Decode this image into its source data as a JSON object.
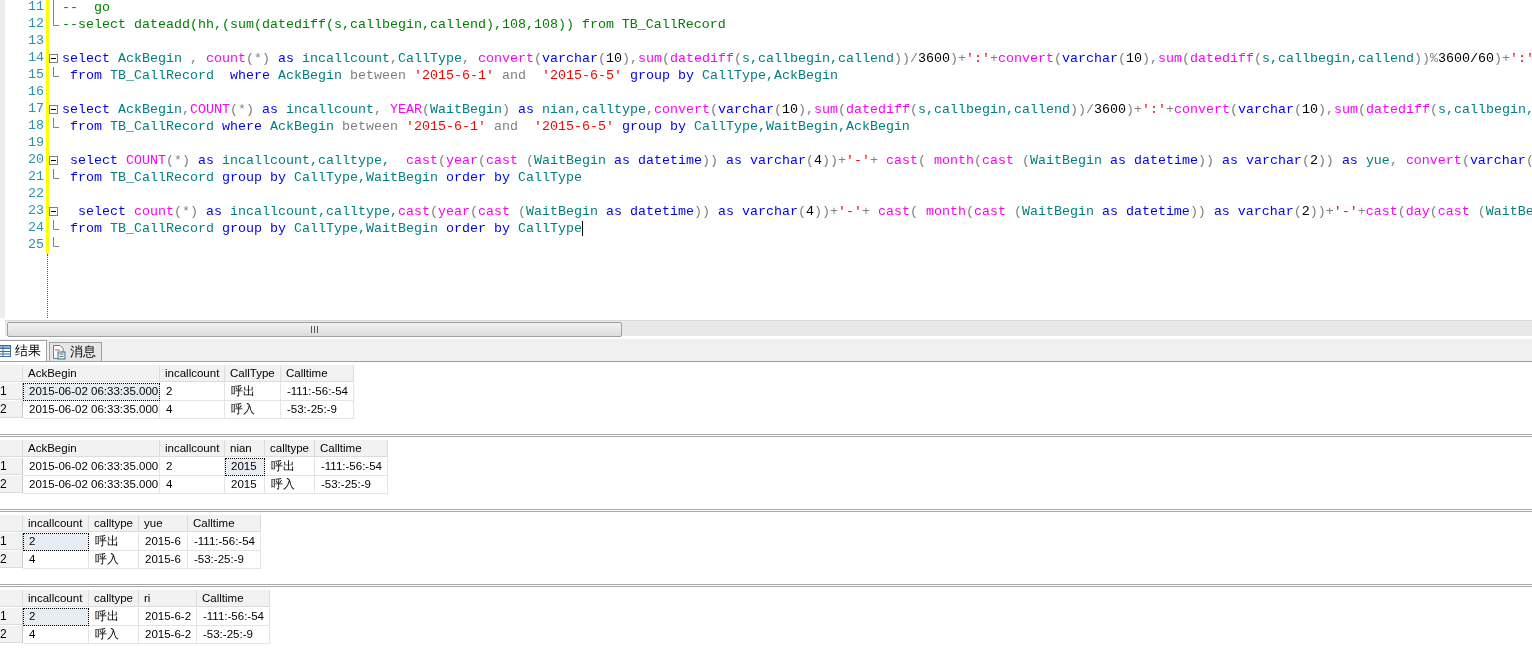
{
  "editor": {
    "lines": [
      {
        "number": "11",
        "kind": "guide",
        "caret": false,
        "tokens": [
          {
            "text": "--  go",
            "kind": "cmt"
          }
        ]
      },
      {
        "number": "12",
        "kind": "end",
        "caret": false,
        "tokens": [
          {
            "text": "--select dateadd(hh,(sum(datediff(s,callbegin,callend),108,108)) from TB_CallRecord",
            "kind": "cmt"
          }
        ]
      },
      {
        "number": "13",
        "caret": false
      },
      {
        "number": "14",
        "kind": "start",
        "caret": false,
        "tokens": [
          {
            "text": "select ",
            "kind": "kw"
          },
          {
            "text": "AckBegin ",
            "kind": "id"
          },
          {
            "text": ", ",
            "kind": "op"
          },
          {
            "text": "count",
            "kind": "fn"
          },
          {
            "text": "(*) ",
            "kind": "op"
          },
          {
            "text": "as ",
            "kind": "kw"
          },
          {
            "text": "incallcount",
            "kind": "id"
          },
          {
            "text": ",",
            "kind": "op"
          },
          {
            "text": "CallType",
            "kind": "id"
          },
          {
            "text": ", ",
            "kind": "op"
          },
          {
            "text": "convert",
            "kind": "fn"
          },
          {
            "text": "(",
            "kind": "op"
          },
          {
            "text": "varchar",
            "kind": "kw"
          },
          {
            "text": "(",
            "kind": "op"
          },
          {
            "text": "10",
            "kind": "num"
          },
          {
            "text": "),",
            "kind": "op"
          },
          {
            "text": "sum",
            "kind": "fn"
          },
          {
            "text": "(",
            "kind": "op"
          },
          {
            "text": "datediff",
            "kind": "fn"
          },
          {
            "text": "(",
            "kind": "op"
          },
          {
            "text": "s,callbegin,callend",
            "kind": "id"
          },
          {
            "text": "))/",
            "kind": "op"
          },
          {
            "text": "3600",
            "kind": "num"
          },
          {
            "text": ")+",
            "kind": "op"
          },
          {
            "text": "':'",
            "kind": "str"
          },
          {
            "text": "+",
            "kind": "op"
          },
          {
            "text": "convert",
            "kind": "fn"
          },
          {
            "text": "(",
            "kind": "op"
          },
          {
            "text": "varchar",
            "kind": "kw"
          },
          {
            "text": "(",
            "kind": "op"
          },
          {
            "text": "10",
            "kind": "num"
          },
          {
            "text": "),",
            "kind": "op"
          },
          {
            "text": "sum",
            "kind": "fn"
          },
          {
            "text": "(",
            "kind": "op"
          },
          {
            "text": "datediff",
            "kind": "fn"
          },
          {
            "text": "(",
            "kind": "op"
          },
          {
            "text": "s,callbegin,callend",
            "kind": "id"
          },
          {
            "text": "))%",
            "kind": "op"
          },
          {
            "text": "3600/60",
            "kind": "num"
          },
          {
            "text": ")+",
            "kind": "op"
          },
          {
            "text": "':'",
            "kind": "str"
          }
        ]
      },
      {
        "number": "15",
        "kind": "end",
        "caret": false,
        "tokens": [
          {
            "text": " from ",
            "kind": "kw"
          },
          {
            "text": "TB_CallRecord  ",
            "kind": "id"
          },
          {
            "text": "where ",
            "kind": "kw"
          },
          {
            "text": "AckBegin ",
            "kind": "id"
          },
          {
            "text": "between ",
            "kind": "op"
          },
          {
            "text": "'2015-6-1'",
            "kind": "str"
          },
          {
            "text": " and  ",
            "kind": "op"
          },
          {
            "text": "'2015-6-5'",
            "kind": "str"
          },
          {
            "text": " group by ",
            "kind": "kw"
          },
          {
            "text": "CallType,AckBegin",
            "kind": "id"
          }
        ]
      },
      {
        "number": "16",
        "caret": false
      },
      {
        "number": "17",
        "kind": "start",
        "caret": false,
        "tokens": [
          {
            "text": "select ",
            "kind": "kw"
          },
          {
            "text": "AckBegin",
            "kind": "id"
          },
          {
            "text": ",",
            "kind": "op"
          },
          {
            "text": "COUNT",
            "kind": "fn"
          },
          {
            "text": "(*) ",
            "kind": "op"
          },
          {
            "text": "as ",
            "kind": "kw"
          },
          {
            "text": "incallcount",
            "kind": "id"
          },
          {
            "text": ", ",
            "kind": "op"
          },
          {
            "text": "YEAR",
            "kind": "fn"
          },
          {
            "text": "(",
            "kind": "op"
          },
          {
            "text": "WaitBegin",
            "kind": "id"
          },
          {
            "text": ") ",
            "kind": "op"
          },
          {
            "text": "as ",
            "kind": "kw"
          },
          {
            "text": "nian,calltype",
            "kind": "id"
          },
          {
            "text": ",",
            "kind": "op"
          },
          {
            "text": "convert",
            "kind": "fn"
          },
          {
            "text": "(",
            "kind": "op"
          },
          {
            "text": "varchar",
            "kind": "kw"
          },
          {
            "text": "(",
            "kind": "op"
          },
          {
            "text": "10",
            "kind": "num"
          },
          {
            "text": "),",
            "kind": "op"
          },
          {
            "text": "sum",
            "kind": "fn"
          },
          {
            "text": "(",
            "kind": "op"
          },
          {
            "text": "datediff",
            "kind": "fn"
          },
          {
            "text": "(",
            "kind": "op"
          },
          {
            "text": "s,callbegin,callend",
            "kind": "id"
          },
          {
            "text": "))/",
            "kind": "op"
          },
          {
            "text": "3600",
            "kind": "num"
          },
          {
            "text": ")+",
            "kind": "op"
          },
          {
            "text": "':'",
            "kind": "str"
          },
          {
            "text": "+",
            "kind": "op"
          },
          {
            "text": "convert",
            "kind": "fn"
          },
          {
            "text": "(",
            "kind": "op"
          },
          {
            "text": "varchar",
            "kind": "kw"
          },
          {
            "text": "(",
            "kind": "op"
          },
          {
            "text": "10",
            "kind": "num"
          },
          {
            "text": "),",
            "kind": "op"
          },
          {
            "text": "sum",
            "kind": "fn"
          },
          {
            "text": "(",
            "kind": "op"
          },
          {
            "text": "datediff",
            "kind": "fn"
          },
          {
            "text": "(",
            "kind": "op"
          },
          {
            "text": "s,callbegin,",
            "kind": "id"
          }
        ]
      },
      {
        "number": "18",
        "kind": "end",
        "caret": false,
        "tokens": [
          {
            "text": " from ",
            "kind": "kw"
          },
          {
            "text": "TB_CallRecord ",
            "kind": "id"
          },
          {
            "text": "where ",
            "kind": "kw"
          },
          {
            "text": "AckBegin ",
            "kind": "id"
          },
          {
            "text": "between ",
            "kind": "op"
          },
          {
            "text": "'2015-6-1'",
            "kind": "str"
          },
          {
            "text": " and  ",
            "kind": "op"
          },
          {
            "text": "'2015-6-5'",
            "kind": "str"
          },
          {
            "text": " group by ",
            "kind": "kw"
          },
          {
            "text": "CallType,WaitBegin,AckBegin",
            "kind": "id"
          }
        ]
      },
      {
        "number": "19",
        "caret": false
      },
      {
        "number": "20",
        "kind": "start",
        "caret": false,
        "tokens": [
          {
            "text": " select ",
            "kind": "kw"
          },
          {
            "text": "COUNT",
            "kind": "fn"
          },
          {
            "text": "(*) ",
            "kind": "op"
          },
          {
            "text": "as ",
            "kind": "kw"
          },
          {
            "text": "incallcount,calltype,  ",
            "kind": "id"
          },
          {
            "text": "cast",
            "kind": "fn"
          },
          {
            "text": "(",
            "kind": "op"
          },
          {
            "text": "year",
            "kind": "fn"
          },
          {
            "text": "(",
            "kind": "op"
          },
          {
            "text": "cast",
            "kind": "fn"
          },
          {
            "text": " (",
            "kind": "op"
          },
          {
            "text": "WaitBegin ",
            "kind": "id"
          },
          {
            "text": "as datetime",
            "kind": "kw"
          },
          {
            "text": ")) ",
            "kind": "op"
          },
          {
            "text": "as varchar",
            "kind": "kw"
          },
          {
            "text": "(",
            "kind": "op"
          },
          {
            "text": "4",
            "kind": "num"
          },
          {
            "text": "))+",
            "kind": "op"
          },
          {
            "text": "'-'",
            "kind": "str"
          },
          {
            "text": "+ ",
            "kind": "op"
          },
          {
            "text": "cast",
            "kind": "fn"
          },
          {
            "text": "( ",
            "kind": "op"
          },
          {
            "text": "month",
            "kind": "fn"
          },
          {
            "text": "(",
            "kind": "op"
          },
          {
            "text": "cast",
            "kind": "fn"
          },
          {
            "text": " (",
            "kind": "op"
          },
          {
            "text": "WaitBegin ",
            "kind": "id"
          },
          {
            "text": "as datetime",
            "kind": "kw"
          },
          {
            "text": ")) ",
            "kind": "op"
          },
          {
            "text": "as varchar",
            "kind": "kw"
          },
          {
            "text": "(",
            "kind": "op"
          },
          {
            "text": "2",
            "kind": "num"
          },
          {
            "text": ")) ",
            "kind": "op"
          },
          {
            "text": "as ",
            "kind": "kw"
          },
          {
            "text": "yue",
            "kind": "id"
          },
          {
            "text": ", ",
            "kind": "op"
          },
          {
            "text": "convert",
            "kind": "fn"
          },
          {
            "text": "(",
            "kind": "op"
          },
          {
            "text": "varchar",
            "kind": "kw"
          },
          {
            "text": "(",
            "kind": "op"
          }
        ]
      },
      {
        "number": "21",
        "kind": "end",
        "caret": false,
        "tokens": [
          {
            "text": " from ",
            "kind": "kw"
          },
          {
            "text": "TB_CallRecord ",
            "kind": "id"
          },
          {
            "text": "group by ",
            "kind": "kw"
          },
          {
            "text": "CallType,WaitBegin ",
            "kind": "id"
          },
          {
            "text": "order by ",
            "kind": "kw"
          },
          {
            "text": "CallType",
            "kind": "id"
          }
        ]
      },
      {
        "number": "22",
        "caret": false
      },
      {
        "number": "23",
        "kind": "start",
        "caret": false,
        "tokens": [
          {
            "text": "  select ",
            "kind": "kw"
          },
          {
            "text": "count",
            "kind": "fn"
          },
          {
            "text": "(*) ",
            "kind": "op"
          },
          {
            "text": "as ",
            "kind": "kw"
          },
          {
            "text": "incallcount,calltype,",
            "kind": "id"
          },
          {
            "text": "cast",
            "kind": "fn"
          },
          {
            "text": "(",
            "kind": "op"
          },
          {
            "text": "year",
            "kind": "fn"
          },
          {
            "text": "(",
            "kind": "op"
          },
          {
            "text": "cast",
            "kind": "fn"
          },
          {
            "text": " (",
            "kind": "op"
          },
          {
            "text": "WaitBegin ",
            "kind": "id"
          },
          {
            "text": "as datetime",
            "kind": "kw"
          },
          {
            "text": ")) ",
            "kind": "op"
          },
          {
            "text": "as varchar",
            "kind": "kw"
          },
          {
            "text": "(",
            "kind": "op"
          },
          {
            "text": "4",
            "kind": "num"
          },
          {
            "text": "))+",
            "kind": "op"
          },
          {
            "text": "'-'",
            "kind": "str"
          },
          {
            "text": "+ ",
            "kind": "op"
          },
          {
            "text": "cast",
            "kind": "fn"
          },
          {
            "text": "( ",
            "kind": "op"
          },
          {
            "text": "month",
            "kind": "fn"
          },
          {
            "text": "(",
            "kind": "op"
          },
          {
            "text": "cast",
            "kind": "fn"
          },
          {
            "text": " (",
            "kind": "op"
          },
          {
            "text": "WaitBegin ",
            "kind": "id"
          },
          {
            "text": "as datetime",
            "kind": "kw"
          },
          {
            "text": ")) ",
            "kind": "op"
          },
          {
            "text": "as varchar",
            "kind": "kw"
          },
          {
            "text": "(",
            "kind": "op"
          },
          {
            "text": "2",
            "kind": "num"
          },
          {
            "text": "))+",
            "kind": "op"
          },
          {
            "text": "'-'",
            "kind": "str"
          },
          {
            "text": "+",
            "kind": "op"
          },
          {
            "text": "cast",
            "kind": "fn"
          },
          {
            "text": "(",
            "kind": "op"
          },
          {
            "text": "day",
            "kind": "fn"
          },
          {
            "text": "(",
            "kind": "op"
          },
          {
            "text": "cast",
            "kind": "fn"
          },
          {
            "text": " (",
            "kind": "op"
          },
          {
            "text": "WaitBe",
            "kind": "id"
          }
        ]
      },
      {
        "number": "24",
        "kind": "end",
        "caret": true,
        "tokens": [
          {
            "text": " from ",
            "kind": "kw"
          },
          {
            "text": "TB_CallRecord ",
            "kind": "id"
          },
          {
            "text": "group by ",
            "kind": "kw"
          },
          {
            "text": "CallType,WaitBegin ",
            "kind": "id"
          },
          {
            "text": "order by ",
            "kind": "kw"
          },
          {
            "text": "CallType",
            "kind": "id"
          }
        ]
      },
      {
        "number": "25",
        "kind": "end",
        "caret": false
      }
    ]
  },
  "result_tabs": [
    {
      "label": "结果",
      "selected": true
    },
    {
      "label": "消息",
      "selected": false
    }
  ],
  "grids": [
    {
      "columns": [
        "AckBegin",
        "incallcount",
        "CallType",
        "Calltime"
      ],
      "rows": [
        {
          "number": "1",
          "cells": [
            {
              "text": "2015-06-02 06:33:35.000",
              "selected": true
            },
            {
              "text": "2",
              "selected": false
            },
            {
              "text": "呼出",
              "selected": false
            },
            {
              "text": "-111:-56:-54",
              "selected": false
            }
          ]
        },
        {
          "number": "2",
          "cells": [
            {
              "text": "2015-06-02 06:33:35.000",
              "selected": false
            },
            {
              "text": "4",
              "selected": false
            },
            {
              "text": "呼入",
              "selected": false
            },
            {
              "text": "-53:-25:-9",
              "selected": false
            }
          ]
        }
      ]
    },
    {
      "columns": [
        "AckBegin",
        "incallcount",
        "nian",
        "calltype",
        "Calltime"
      ],
      "rows": [
        {
          "number": "1",
          "cells": [
            {
              "text": "2015-06-02 06:33:35.000",
              "selected": false
            },
            {
              "text": "2",
              "selected": false
            },
            {
              "text": "2015",
              "selected": true
            },
            {
              "text": "呼出",
              "selected": false
            },
            {
              "text": "-111:-56:-54",
              "selected": false
            }
          ]
        },
        {
          "number": "2",
          "cells": [
            {
              "text": "2015-06-02 06:33:35.000",
              "selected": false
            },
            {
              "text": "4",
              "selected": false
            },
            {
              "text": "2015",
              "selected": false
            },
            {
              "text": "呼入",
              "selected": false
            },
            {
              "text": "-53:-25:-9",
              "selected": false
            }
          ]
        }
      ]
    },
    {
      "columns": [
        "incallcount",
        "calltype",
        "yue",
        "Calltime"
      ],
      "rows": [
        {
          "number": "1",
          "cells": [
            {
              "text": "2",
              "selected": true
            },
            {
              "text": "呼出",
              "selected": false
            },
            {
              "text": "2015-6",
              "selected": false
            },
            {
              "text": "-111:-56:-54",
              "selected": false
            }
          ]
        },
        {
          "number": "2",
          "cells": [
            {
              "text": "4",
              "selected": false
            },
            {
              "text": "呼入",
              "selected": false
            },
            {
              "text": "2015-6",
              "selected": false
            },
            {
              "text": "-53:-25:-9",
              "selected": false
            }
          ]
        }
      ]
    },
    {
      "columns": [
        "incallcount",
        "calltype",
        "ri",
        "Calltime"
      ],
      "rows": [
        {
          "number": "1",
          "cells": [
            {
              "text": "2",
              "selected": true
            },
            {
              "text": "呼出",
              "selected": false
            },
            {
              "text": "2015-6-2",
              "selected": false
            },
            {
              "text": "-111:-56:-54",
              "selected": false
            }
          ]
        },
        {
          "number": "2",
          "cells": [
            {
              "text": "4",
              "selected": false
            },
            {
              "text": "呼入",
              "selected": false
            },
            {
              "text": "2015-6-2",
              "selected": false
            },
            {
              "text": "-53:-25:-9",
              "selected": false
            }
          ]
        }
      ]
    }
  ]
}
